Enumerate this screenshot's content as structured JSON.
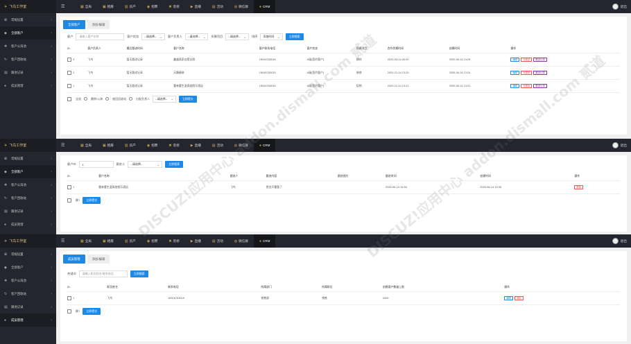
{
  "topbar": {
    "logo": "飞鸟工作室",
    "nav": [
      {
        "label": "全局",
        "icon": "grid-icon"
      },
      {
        "label": "相册",
        "icon": "image-icon"
      },
      {
        "label": "房产",
        "icon": "building-icon"
      },
      {
        "label": "招聘",
        "icon": "briefcase-icon"
      },
      {
        "label": "装修",
        "icon": "tools-icon"
      },
      {
        "label": "直播",
        "icon": "video-icon"
      },
      {
        "label": "活动",
        "icon": "calendar-icon"
      },
      {
        "label": "微信群",
        "icon": "chat-icon"
      },
      {
        "label": "CRM",
        "icon": "user-icon"
      }
    ],
    "logout": "退出"
  },
  "sidebar": {
    "items": [
      "常规设置",
      "全部客户",
      "客户公海池",
      "客户回收站",
      "跟进记录",
      "成员管理"
    ]
  },
  "screen1": {
    "tabs": [
      "全部客户",
      "添加/编辑"
    ],
    "filters": {
      "customer_label": "客户",
      "customer_placeholder": "请输入客户名称",
      "group_label": "客户状态",
      "group_value": "--请选择--",
      "owner_label": "客户负责人",
      "owner_value": "--请选择--",
      "project_label": "所属项目",
      "project_value": "--请选择--",
      "sort_label": "排序",
      "sort_value": "添加时间",
      "search_btn": "立即搜索"
    },
    "columns": [
      "ID",
      "客户负责人",
      "最后跟进时间",
      "客户名称",
      "客户联系电话",
      "客户状态",
      "所属项目",
      "合作到期时间",
      "创建时间",
      "操作"
    ],
    "rows": [
      {
        "id": "3",
        "owner": "飞鸟",
        "last": "暂无跟进记录",
        "name": "鑫盛昌家去壁支割",
        "phone": "15916763015",
        "status": "A级(签约客户)",
        "project": "建材",
        "expire": "2023-03-14 00:00",
        "created": "2020-06-14 13:29"
      },
      {
        "id": "2",
        "owner": "飞鸟",
        "last": "暂无跟进记录",
        "name": "天籁精装",
        "phone": "15916763015",
        "status": "A级(签约客户)",
        "project": "装修",
        "expire": "2020-12-14 13:25",
        "created": "2020-06-14 13:24"
      },
      {
        "id": "1",
        "owner": "飞鸟",
        "last": "暂无跟进记录",
        "name": "重来重生温泉度假乐酒店",
        "phone": "15916763015",
        "status": "A级(签约客户)",
        "project": "促销",
        "expire": "2020-12-14 13:21",
        "created": "2020-06-14 13:21"
      }
    ],
    "ops": [
      "编辑",
      "写跟进",
      "跟进记录"
    ],
    "bottom": {
      "select_all": "全选",
      "r1": "删除/公海",
      "r2": "放回回收站",
      "r3": "分配负责人",
      "select": "--请选择--",
      "submit": "立即提交"
    }
  },
  "screen2": {
    "filters": {
      "id_label": "客户ID",
      "id_value": "1",
      "follow_label": "跟进人",
      "follow_value": "--请选择--",
      "search_btn": "立即搜索"
    },
    "columns": [
      "ID",
      "客户名称",
      "跟进人",
      "跟进内容",
      "跟进图片",
      "跟进时间",
      "创建时间",
      "操作"
    ],
    "rows": [
      {
        "id": "1",
        "name": "重来重生温泉度假乐酒店",
        "follower": "飞鸟",
        "content": "首金开重整了",
        "image": "",
        "time": "2020-06-14 13:35",
        "created": "2020-06-14 13:35"
      }
    ],
    "op": "删除",
    "bottom": {
      "select_all": "删?",
      "submit": "立即提交"
    }
  },
  "screen3": {
    "tabs": [
      "成员管理",
      "添加/编辑"
    ],
    "filters": {
      "label": "关键词",
      "placeholder": "请输入职员姓名/联系电话",
      "search_btn": "立即搜索"
    },
    "columns": [
      "ID",
      "职员姓名",
      "联系电话",
      "所属部门",
      "所属职位",
      "创建客户数量上限",
      "操作"
    ],
    "rows": [
      {
        "id": "1",
        "name": "飞鸟",
        "phone": "15916763015",
        "dept": "销售部",
        "pos": "销售",
        "limit": "1000"
      }
    ],
    "ops": [
      "编辑",
      "删除"
    ],
    "bottom": {
      "select_all": "删?",
      "submit": "立即提交"
    }
  },
  "watermark": "DISCUZ!应用中心 addon.dismall.com 贰道"
}
